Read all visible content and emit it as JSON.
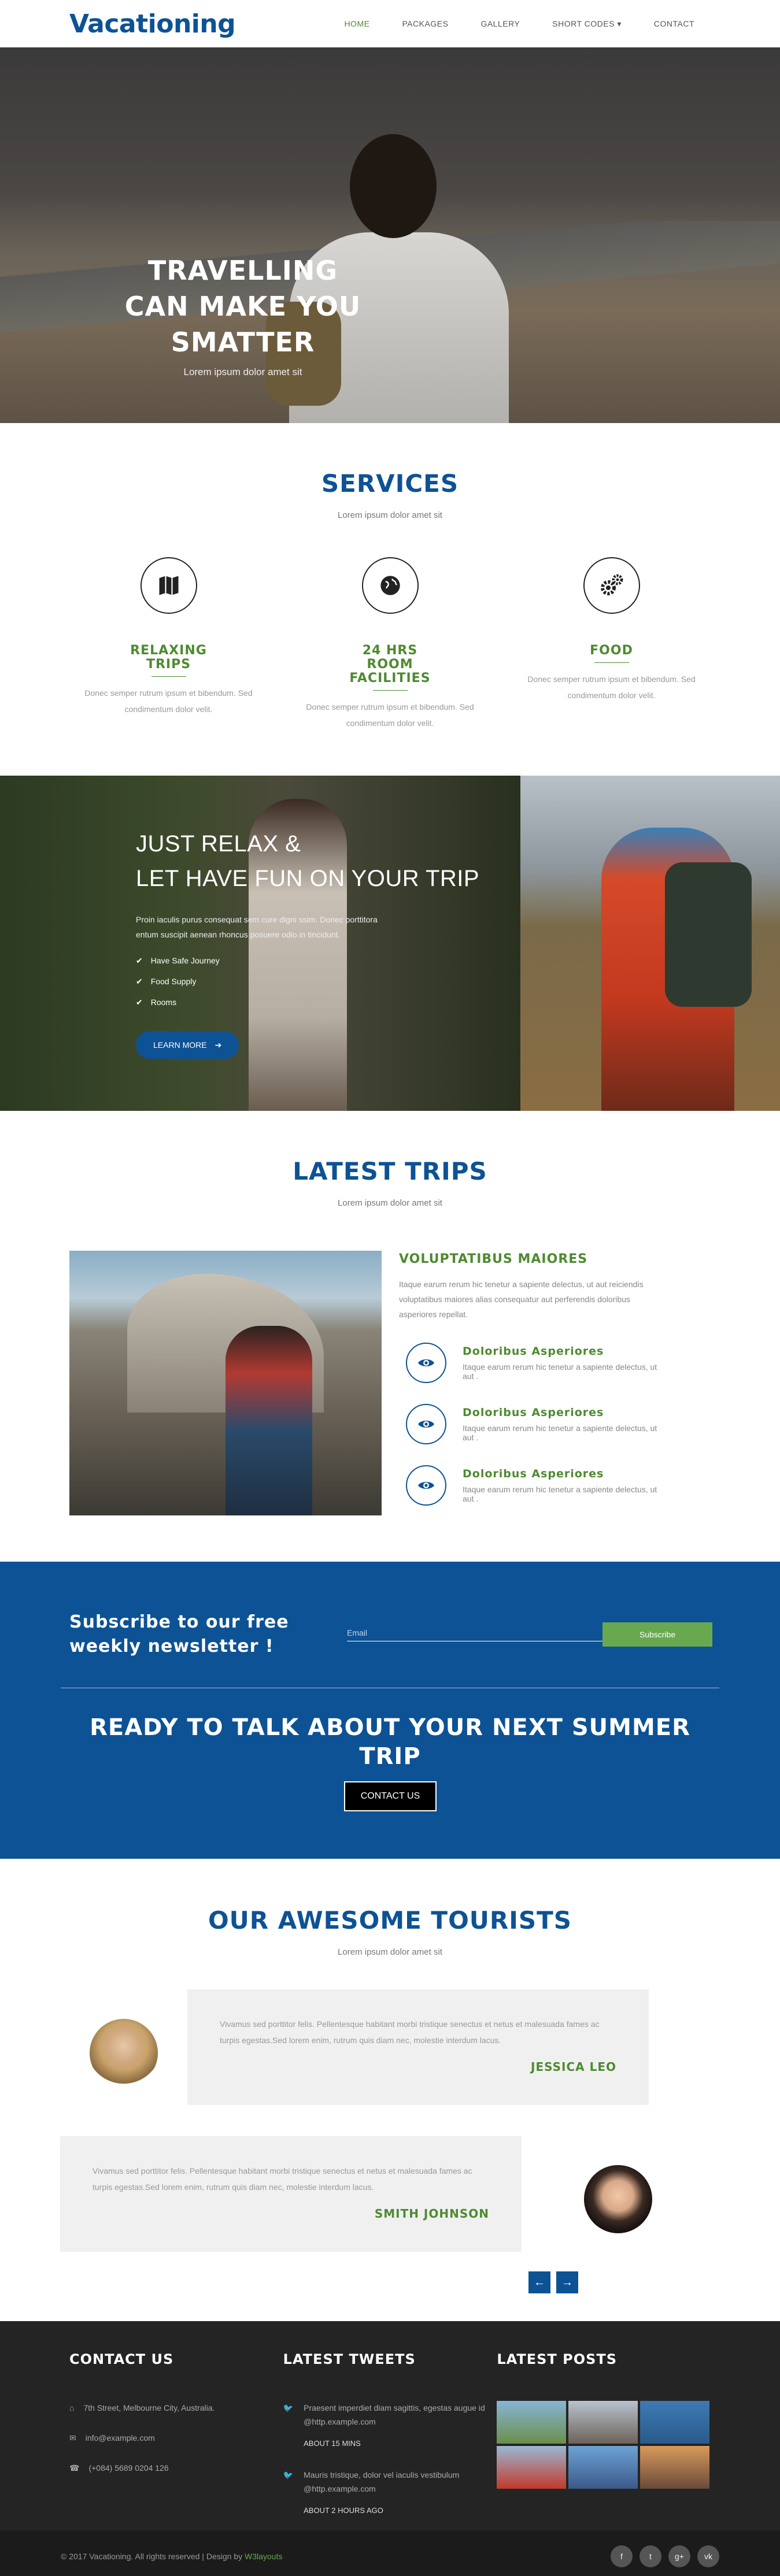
{
  "header": {
    "logo": "Vacationing",
    "nav": [
      "HOME",
      "PACKAGES",
      "GALLERY",
      "SHORT CODES",
      "CONTACT"
    ],
    "short_codes_caret": "▾"
  },
  "hero": {
    "title_lines": [
      "TRAVELLING",
      "CAN MAKE YOU",
      "SMATTER"
    ],
    "subtitle": "Lorem ipsum dolor amet sit"
  },
  "services": {
    "title": "SERVICES",
    "subtitle": "Lorem ipsum dolor amet sit",
    "items": [
      {
        "title": "RELAXING TRIPS",
        "text": "Donec semper rutrum ipsum et bibendum. Sed condimentum dolor velit.",
        "icon": "map-icon"
      },
      {
        "title": "24 HRS ROOM FACILITIES",
        "text": "Donec semper rutrum ipsum et bibendum. Sed condimentum dolor velit.",
        "icon": "globe-icon"
      },
      {
        "title": "FOOD",
        "text": "Donec semper rutrum ipsum et bibendum. Sed condimentum dolor velit.",
        "icon": "gears-icon"
      }
    ]
  },
  "relax": {
    "title_lines": [
      "JUST RELAX &",
      "LET HAVE FUN ON YOUR TRIP"
    ],
    "text": "Proin iaculis purus consequat sem cure digni ssim. Donec porttitora entum suscipit aenean rhoncus posuere odio in tincidunt.",
    "list": [
      "Have Safe Journey",
      "Food Supply",
      "Rooms"
    ],
    "button": "LEARN MORE"
  },
  "trips": {
    "title": "LATEST TRIPS",
    "subtitle": "Lorem ipsum dolor amet sit",
    "heading": "VOLUPTATIBUS MAIORES",
    "lead": "Itaque earum rerum hic tenetur a sapiente delectus, ut aut reiciendis voluptatibus maiores alias consequatur aut perferendis doloribus asperiores repellat.",
    "features": [
      {
        "title": "Doloribus Asperiores",
        "text": "Itaque earum rerum hic tenetur a sapiente delectus, ut aut ."
      },
      {
        "title": "Doloribus Asperiores",
        "text": "Itaque earum rerum hic tenetur a sapiente delectus, ut aut ."
      },
      {
        "title": "Doloribus Asperiores",
        "text": "Itaque earum rerum hic tenetur a sapiente delectus, ut aut ."
      }
    ]
  },
  "newsletter": {
    "title": "Subscribe to our free weekly newsletter !",
    "email_placeholder": "Email",
    "button": "Subscribe",
    "ready": "READY TO TALK ABOUT YOUR NEXT SUMMER TRIP",
    "contact_button": "CONTACT US"
  },
  "tourists": {
    "title": "OUR AWESOME TOURISTS",
    "subtitle": "Lorem ipsum dolor amet sit",
    "testimonials": [
      {
        "text": "Vivamus sed porttitor felis. Pellentesque habitant morbi tristique senectus et netus et malesuada fames ac turpis egestas.Sed lorem enim, rutrum quis diam nec, molestie interdum lacus.",
        "name": "JESSICA LEO"
      },
      {
        "text": "Vivamus sed porttitor felis. Pellentesque habitant morbi tristique senectus et netus et malesuada fames ac turpis egestas.Sed lorem enim, rutrum quis diam nec, molestie interdum lacus.",
        "name": "SMITH JOHNSON"
      }
    ]
  },
  "footer": {
    "contact_title": "CONTACT US",
    "address": "7th Street, Melbourne City, Australia.",
    "email": "info@example.com",
    "phone": "(+084) 5689 0204 126",
    "tweets_title": "LATEST TWEETS",
    "tweets": [
      {
        "text": "Praesent imperdiet diam sagittis, egestas augue id @http.example.com",
        "time": "ABOUT 15 MINS"
      },
      {
        "text": "Mauris tristique, dolor vel iaculis vestibulum @http.example.com",
        "time": "ABOUT 2 HOURS AGO"
      }
    ],
    "posts_title": "LATEST POSTS",
    "copyright": "© 2017 Vacationing. All rights reserved | Design by",
    "designer": "W3layouts",
    "social": [
      "f",
      "t",
      "g+",
      "vk"
    ]
  },
  "colors": {
    "primary": "#0d5294",
    "green": "#4e8a2f",
    "footer": "#242424"
  }
}
